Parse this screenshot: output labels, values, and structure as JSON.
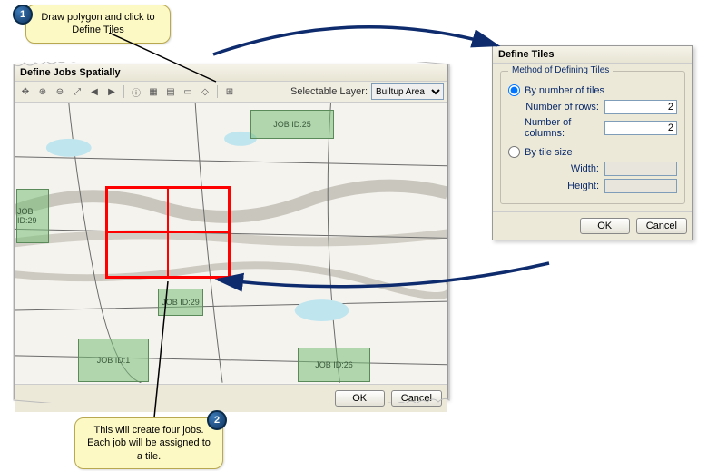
{
  "main_window": {
    "title": "Define Jobs Spatially",
    "selectable_layer_label": "Selectable Layer:",
    "selectable_layer_value": "Builtup Area",
    "jobs": {
      "j25": "JOB ID:25",
      "j29": "JOB ID:29",
      "j29b": "JOB ID:29",
      "j1": "JOB ID:1",
      "j26": "JOB ID:26"
    },
    "ok": "OK",
    "cancel": "Cancel"
  },
  "define_tiles": {
    "title": "Define Tiles",
    "group_title": "Method of Defining Tiles",
    "by_number_label": "By number of tiles",
    "rows_label": "Number of rows:",
    "rows_value": "2",
    "cols_label": "Number of columns:",
    "cols_value": "2",
    "by_size_label": "By tile size",
    "width_label": "Width:",
    "height_label": "Height:",
    "ok": "OK",
    "cancel": "Cancel"
  },
  "callouts": {
    "c1": "Draw polygon and click to Define Tiles",
    "c2": "This will create four jobs. Each job will be assigned to a tile."
  },
  "badges": {
    "b1": "1",
    "b2": "2"
  },
  "icons": {
    "pan": "✥",
    "zoomin": "⊕",
    "zoomout": "⊖",
    "full": "⤢",
    "prev": "◀",
    "next": "▶",
    "info": "ⓘ",
    "layers": "▦",
    "grid": "▤",
    "select": "▭",
    "poly": "◇",
    "tiles": "⊞"
  }
}
